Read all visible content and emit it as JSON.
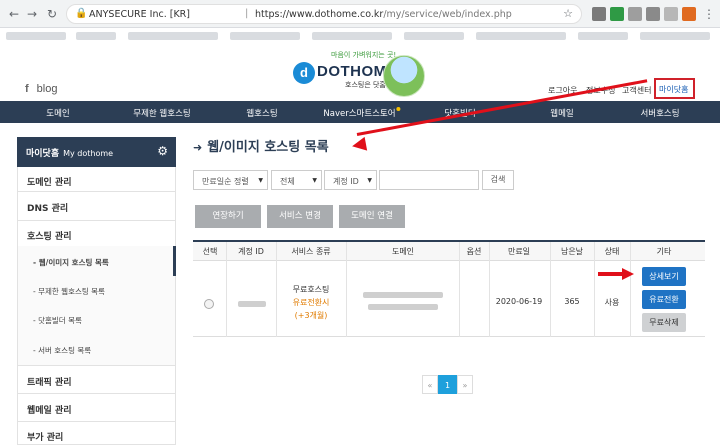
{
  "browser": {
    "secure_label": "ANYSECURE Inc. [KR]",
    "url_host": "https://www.dothome.co.kr",
    "url_path": "/my/service/web/index.php"
  },
  "header": {
    "blog_icon": "f",
    "blog_label": "blog",
    "logo_mark": "d",
    "logo_name": "DOTHOME",
    "logo_slogan": "마음이 가벼워지는 곳!",
    "logo_tag": "호스팅은 닷홈",
    "top_links": [
      "로그아웃",
      "정보수정",
      "고객센터"
    ],
    "my_dothome": "마이닷홈"
  },
  "nav": [
    "도메인",
    "무제한 웹호스팅",
    "웹호스팅",
    "Naver스마트스토어",
    "닷홈빌더",
    "웹메일",
    "서버호스팅"
  ],
  "sidebar": {
    "title": "마이닷홈",
    "subtitle": "My dothome",
    "items": [
      "도메인 관리",
      "DNS 관리",
      "호스팅 관리"
    ],
    "subitems": [
      "- 웹/이미지 호스팅 목록",
      "- 무제한 웹호스팅 목록",
      "- 닷홈빌더 목록",
      "- 서버 호스팅 목록"
    ],
    "items_after": [
      "트래픽 관리",
      "웹메일 관리",
      "부가 관리"
    ]
  },
  "content": {
    "title": "웹/이미지 호스팅 목록",
    "filters": {
      "sort": "만료일순 정렬",
      "type": "전체",
      "field": "계정 ID",
      "search_button": "검색"
    },
    "actions": [
      "연장하기",
      "서비스 변경",
      "도메인 연결"
    ],
    "table": {
      "headers": [
        "선택",
        "계정 ID",
        "서비스 종류",
        "도메인",
        "옵션",
        "만료일",
        "남은날",
        "상태",
        "기타"
      ],
      "row": {
        "service_type": "무료호스팅",
        "service_sub": "유료전환시",
        "service_promo": "(+3개월)",
        "expiry": "2020-06-19",
        "days_left": "365",
        "status": "사용",
        "buttons": [
          "상세보기",
          "유료전환",
          "무료삭제"
        ]
      }
    },
    "pagination": {
      "prev": "«",
      "current": "1",
      "next": "»"
    }
  },
  "colors": {
    "navy": "#2c3e55",
    "blue_button": "#1f73c4",
    "gray_button": "#a9acaf",
    "annotation_red": "#e0101a",
    "promo_orange": "#e07b00"
  }
}
